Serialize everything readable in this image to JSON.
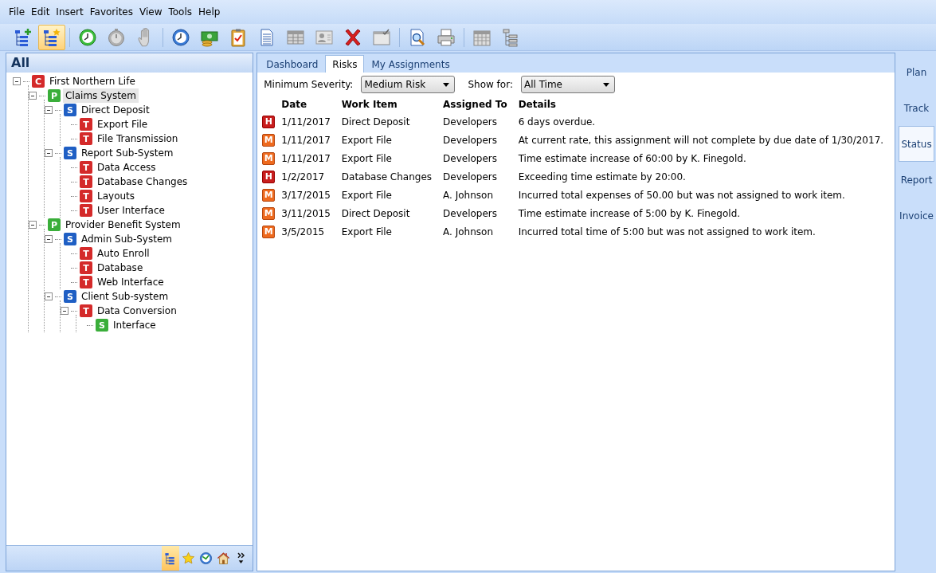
{
  "menu": [
    "File",
    "Edit",
    "Insert",
    "Favorites",
    "View",
    "Tools",
    "Help"
  ],
  "toolbar": [
    {
      "kind": "tree-add",
      "selected": false
    },
    {
      "kind": "tree-star",
      "selected": true
    },
    {
      "kind": "separator"
    },
    {
      "kind": "clock-green",
      "selected": false
    },
    {
      "kind": "stopwatch",
      "selected": false
    },
    {
      "kind": "hand",
      "selected": false
    },
    {
      "kind": "separator"
    },
    {
      "kind": "clock-blue",
      "selected": false
    },
    {
      "kind": "money",
      "selected": false
    },
    {
      "kind": "clipboard",
      "selected": false
    },
    {
      "kind": "document",
      "selected": false
    },
    {
      "kind": "table",
      "selected": false
    },
    {
      "kind": "contact",
      "selected": false
    },
    {
      "kind": "delete",
      "selected": false
    },
    {
      "kind": "window-check",
      "selected": false
    },
    {
      "kind": "separator"
    },
    {
      "kind": "preview",
      "selected": false
    },
    {
      "kind": "printer",
      "selected": false
    },
    {
      "kind": "separator"
    },
    {
      "kind": "calendar",
      "selected": false
    },
    {
      "kind": "tree-list",
      "selected": false
    }
  ],
  "left_panel": {
    "title": "All",
    "tree": [
      {
        "badge": "C",
        "kind": "client",
        "label": "First Northern Life",
        "selected": false,
        "expanded": true,
        "children": [
          {
            "badge": "P",
            "kind": "project",
            "label": "Claims System",
            "selected": true,
            "expanded": true,
            "children": [
              {
                "badge": "S",
                "kind": "system",
                "label": "Direct Deposit",
                "selected": false,
                "expanded": true,
                "children": [
                  {
                    "badge": "T",
                    "kind": "task",
                    "label": "Export File",
                    "selected": false
                  },
                  {
                    "badge": "T",
                    "kind": "task",
                    "label": "File Transmission",
                    "selected": false
                  }
                ]
              },
              {
                "badge": "S",
                "kind": "system",
                "label": "Report Sub-System",
                "selected": false,
                "expanded": true,
                "children": [
                  {
                    "badge": "T",
                    "kind": "task",
                    "label": "Data Access",
                    "selected": false
                  },
                  {
                    "badge": "T",
                    "kind": "task",
                    "label": "Database Changes",
                    "selected": false
                  },
                  {
                    "badge": "T",
                    "kind": "task",
                    "label": "Layouts",
                    "selected": false
                  },
                  {
                    "badge": "T",
                    "kind": "task",
                    "label": "User Interface",
                    "selected": false
                  }
                ]
              }
            ]
          },
          {
            "badge": "P",
            "kind": "project",
            "label": "Provider Benefit System",
            "selected": false,
            "expanded": true,
            "children": [
              {
                "badge": "S",
                "kind": "system",
                "label": "Admin Sub-System",
                "selected": false,
                "expanded": true,
                "children": [
                  {
                    "badge": "T",
                    "kind": "task",
                    "label": "Auto Enroll",
                    "selected": false
                  },
                  {
                    "badge": "T",
                    "kind": "task",
                    "label": "Database",
                    "selected": false
                  },
                  {
                    "badge": "T",
                    "kind": "task",
                    "label": "Web Interface",
                    "selected": false
                  }
                ]
              },
              {
                "badge": "S",
                "kind": "system",
                "label": "Client Sub-system",
                "selected": false,
                "expanded": true,
                "children": [
                  {
                    "badge": "T",
                    "kind": "task",
                    "label": "Data Conversion",
                    "selected": false,
                    "expanded": true,
                    "children": [
                      {
                        "badge": "S",
                        "kind": "subtask",
                        "label": "Interface",
                        "selected": false
                      }
                    ]
                  }
                ]
              }
            ]
          }
        ]
      }
    ],
    "bottom_bar": [
      {
        "kind": "tree",
        "selected": true
      },
      {
        "kind": "star",
        "selected": false
      },
      {
        "kind": "clock",
        "selected": false
      },
      {
        "kind": "home",
        "selected": false
      },
      {
        "kind": "more",
        "selected": false
      }
    ]
  },
  "tabs": [
    {
      "label": "Dashboard",
      "selected": false
    },
    {
      "label": "Risks",
      "selected": true
    },
    {
      "label": "My Assignments",
      "selected": false
    }
  ],
  "filters": [
    {
      "label": "Minimum Severity:",
      "value": "Medium Risk"
    },
    {
      "label": "Show for:",
      "value": "All Time"
    }
  ],
  "table": {
    "columns": [
      "Date",
      "Work Item",
      "Assigned To",
      "Details"
    ],
    "rows": [
      {
        "severity": "H",
        "kind": "high",
        "cells": [
          "1/11/2017",
          "Direct Deposit",
          "Developers",
          "6 days overdue."
        ]
      },
      {
        "severity": "M",
        "kind": "medium",
        "cells": [
          "1/11/2017",
          "Export File",
          "Developers",
          "At current rate, this assignment will not complete by due date of 1/30/2017."
        ]
      },
      {
        "severity": "M",
        "kind": "medium",
        "cells": [
          "1/11/2017",
          "Export File",
          "Developers",
          "Time estimate increase of 60:00 by K. Finegold."
        ]
      },
      {
        "severity": "H",
        "kind": "high",
        "cells": [
          "1/2/2017",
          "Database Changes",
          "Developers",
          "Exceeding time estimate by 20:00."
        ]
      },
      {
        "severity": "M",
        "kind": "medium",
        "cells": [
          "3/17/2015",
          "Export File",
          "A. Johnson",
          "Incurred total expenses of 50.00 but was not assigned to work item."
        ]
      },
      {
        "severity": "M",
        "kind": "medium",
        "cells": [
          "3/11/2015",
          "Direct Deposit",
          "Developers",
          "Time estimate increase of 5:00 by K. Finegold."
        ]
      },
      {
        "severity": "M",
        "kind": "medium",
        "cells": [
          "3/5/2015",
          "Export File",
          "A. Johnson",
          "Incurred total time of 5:00 but was not assigned to work item."
        ]
      }
    ]
  },
  "side_tabs": [
    {
      "label": "Plan",
      "selected": false
    },
    {
      "label": "Track",
      "selected": false
    },
    {
      "label": "Status",
      "selected": true
    },
    {
      "label": "Report",
      "selected": false
    },
    {
      "label": "Invoice",
      "selected": false
    }
  ]
}
